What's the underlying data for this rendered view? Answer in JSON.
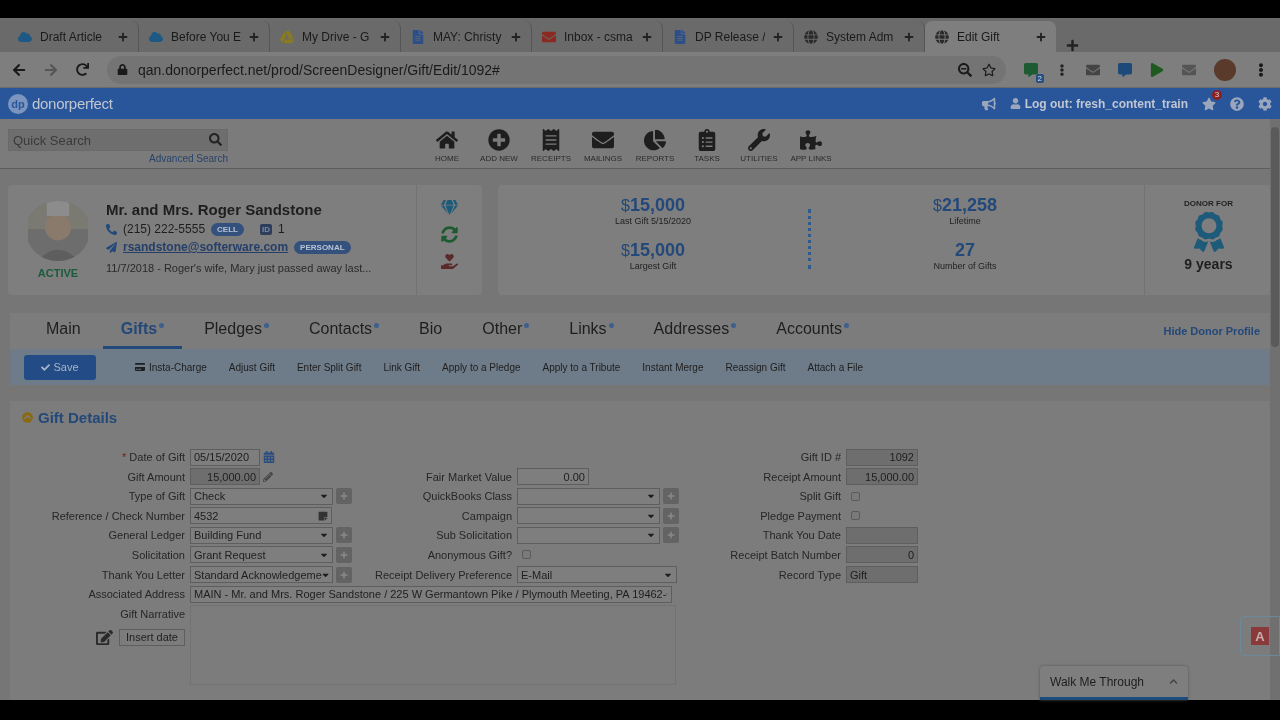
{
  "browser": {
    "tabs": [
      {
        "title": "Draft Article",
        "kind": "cloud",
        "selected": false
      },
      {
        "title": "Before You E",
        "kind": "cloud",
        "selected": false
      },
      {
        "title": "My Drive - G",
        "kind": "drive",
        "selected": false
      },
      {
        "title": "MAY: Christy",
        "kind": "doc",
        "selected": false
      },
      {
        "title": "Inbox - csma",
        "kind": "mail",
        "selected": false
      },
      {
        "title": "DP Release /",
        "kind": "doc",
        "selected": false
      },
      {
        "title": "System Adm",
        "kind": "globe",
        "selected": false
      },
      {
        "title": "Edit Gift",
        "kind": "globe",
        "selected": true
      }
    ],
    "url": "qan.donorperfect.net/prod/ScreenDesigner/Gift/Edit/1092#",
    "extension_badge": "2"
  },
  "app": {
    "logo_mark": "dp",
    "logo_text": "donorperfect",
    "logout": "Log out: fresh_content_train",
    "alert_count": "3",
    "search": {
      "placeholder": "Quick Search",
      "advanced_link": "Advanced Search"
    },
    "nav": [
      {
        "label": "HOME",
        "kind": "home"
      },
      {
        "label": "ADD NEW",
        "kind": "add"
      },
      {
        "label": "RECEIPTS",
        "kind": "receipt"
      },
      {
        "label": "MAILINGS",
        "kind": "mail"
      },
      {
        "label": "REPORTS",
        "kind": "pie"
      },
      {
        "label": "TASKS",
        "kind": "tasks"
      },
      {
        "label": "UTILITIES",
        "kind": "wrench"
      },
      {
        "label": "APP LINKS",
        "kind": "puzzle"
      }
    ]
  },
  "donor": {
    "name": "Mr. and Mrs. Roger Sandstone",
    "phone": "(215) 222-5555",
    "phone_tag": "CELL",
    "id_tag": "ID",
    "id": "1",
    "email": "rsandstone@softerware.com",
    "email_tag": "PERSONAL",
    "status": "ACTIVE",
    "note": "11/7/2018 - Roger's wife, Mary just passed away last...",
    "stats": [
      {
        "currency": "$",
        "amount": "15,000",
        "label": "Last Gift 5/15/2020"
      },
      {
        "currency": "$",
        "amount": "21,258",
        "label": "Lifetime"
      },
      {
        "currency": "$",
        "amount": "15,000",
        "label": "Largest Gift"
      },
      {
        "amount": "27",
        "label": "Number of Gifts"
      }
    ],
    "donor_for": {
      "label": "DONOR FOR",
      "value": "9 years"
    }
  },
  "tabs": [
    {
      "label": "Main",
      "dot": false,
      "selected": false
    },
    {
      "label": "Gifts",
      "dot": true,
      "selected": true
    },
    {
      "label": "Pledges",
      "dot": true,
      "selected": false
    },
    {
      "label": "Contacts",
      "dot": true,
      "selected": false
    },
    {
      "label": "Bio",
      "dot": false,
      "selected": false
    },
    {
      "label": "Other",
      "dot": true,
      "selected": false
    },
    {
      "label": "Links",
      "dot": true,
      "selected": false
    },
    {
      "label": "Addresses",
      "dot": true,
      "selected": false
    },
    {
      "label": "Accounts",
      "dot": true,
      "selected": false
    }
  ],
  "hide_profile_link": "Hide Donor Profile",
  "toolbar": {
    "save": "Save",
    "actions": [
      {
        "label": "Insta-Charge",
        "icon": true
      },
      {
        "label": "Adjust Gift",
        "icon": false
      },
      {
        "label": "Enter Split Gift",
        "icon": false
      },
      {
        "label": "Link Gift",
        "icon": false
      },
      {
        "label": "Apply to a Pledge",
        "icon": false
      },
      {
        "label": "Apply to a Tribute",
        "icon": false
      },
      {
        "label": "Instant Merge",
        "icon": false
      },
      {
        "label": "Reassign Gift",
        "icon": false
      },
      {
        "label": "Attach a File",
        "icon": false
      }
    ]
  },
  "section": {
    "title": "Gift Details",
    "rows": [
      {
        "left": {
          "label": "Date of Gift",
          "required_mark": "*",
          "kind": "date",
          "value": "05/15/2020"
        },
        "right": {
          "label": "Gift ID #",
          "kind": "readonly",
          "value": "1092"
        }
      },
      {
        "left": {
          "label": "Gift Amount",
          "kind": "amount",
          "value": "15,000.00"
        },
        "middle": {
          "label": "Fair Market Value",
          "kind": "number",
          "value": "0.00"
        },
        "right": {
          "label": "Receipt Amount",
          "kind": "readonly",
          "value": "15,000.00"
        }
      },
      {
        "left": {
          "label": "Type of Gift",
          "kind": "select",
          "value": "Check",
          "plus": true
        },
        "middle": {
          "label": "QuickBooks Class",
          "kind": "select",
          "plus": true
        },
        "right": {
          "label": "Split Gift",
          "kind": "checkbox",
          "checked": false
        }
      },
      {
        "left": {
          "label": "Reference / Check Number",
          "kind": "note",
          "value": "4532"
        },
        "middle": {
          "label": "Campaign",
          "kind": "select",
          "plus": true
        },
        "right": {
          "label": "Pledge Payment",
          "kind": "checkbox",
          "checked": false
        }
      },
      {
        "left": {
          "label": "General Ledger",
          "kind": "select",
          "value": "Building Fund",
          "plus": true
        },
        "middle": {
          "label": "Sub Solicitation",
          "kind": "select",
          "plus": true
        },
        "right": {
          "label": "Thank You Date",
          "kind": "readonly"
        }
      },
      {
        "left": {
          "label": "Solicitation",
          "kind": "select",
          "value": "Grant Request",
          "plus": true
        },
        "middle": {
          "label": "Anonymous Gift?",
          "kind": "checkbox",
          "checked": false
        },
        "right": {
          "label": "Receipt Batch Number",
          "kind": "readonly",
          "value": "0"
        }
      },
      {
        "left": {
          "label": "Thank You Letter",
          "kind": "select",
          "value": "Standard Acknowledgeme",
          "plus": true
        },
        "middle": {
          "label": "Receipt Delivery Preference",
          "kind": "select",
          "value": "E-Mail"
        },
        "right": {
          "label": "Record Type",
          "kind": "readonly_left",
          "value": "Gift"
        }
      },
      {
        "left": {
          "label": "Associated Address",
          "kind": "wide_select",
          "value": "MAIN - Mr. and Mrs. Roger Sandstone / 225 W Germantown Pike / Plymouth Meeting, PA 19462-"
        }
      },
      {
        "left": {
          "label": "Gift Narrative",
          "kind": "textarea"
        }
      }
    ],
    "insert_date": "Insert date"
  },
  "walkme": "Walk Me Through",
  "feedback_label": "A"
}
